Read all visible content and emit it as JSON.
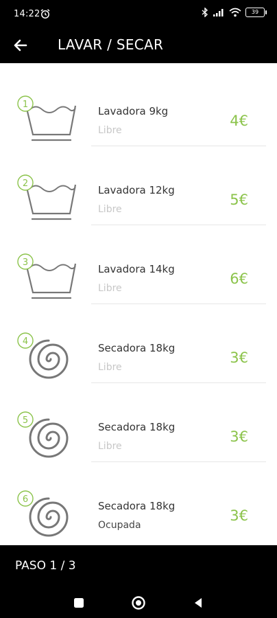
{
  "status_bar": {
    "time": "14:22",
    "battery": "39"
  },
  "header": {
    "title": "LAVAR / SECAR"
  },
  "machines": [
    {
      "number": "1",
      "type": "washer",
      "name": "Lavadora 9kg",
      "status": "Libre",
      "price": "4€"
    },
    {
      "number": "2",
      "type": "washer",
      "name": "Lavadora 12kg",
      "status": "Libre",
      "price": "5€"
    },
    {
      "number": "3",
      "type": "washer",
      "name": "Lavadora 14kg",
      "status": "Libre",
      "price": "6€"
    },
    {
      "number": "4",
      "type": "dryer",
      "name": "Secadora 18kg",
      "status": "Libre",
      "price": "3€"
    },
    {
      "number": "5",
      "type": "dryer",
      "name": "Secadora 18kg",
      "status": "Libre",
      "price": "3€"
    },
    {
      "number": "6",
      "type": "dryer",
      "name": "Secadora 18kg",
      "status": "Ocupada",
      "price": "3€"
    }
  ],
  "footer": {
    "step_label": "PASO 1 / 3"
  },
  "colors": {
    "accent": "#8bc34a",
    "bar": "#000000",
    "status_free": "#c7c7c7",
    "status_busy": "#444444"
  },
  "icons": {
    "washer": "washtub-icon",
    "dryer": "dryer-spiral-icon",
    "back": "arrow-left-icon",
    "nav_recents": "square-icon",
    "nav_home": "circle-icon",
    "nav_back": "triangle-back-icon"
  }
}
